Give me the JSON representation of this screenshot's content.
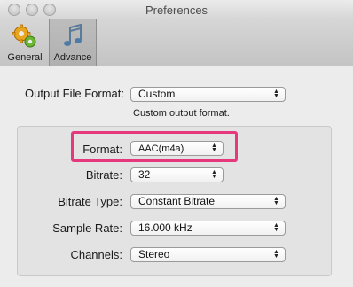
{
  "window": {
    "title": "Preferences"
  },
  "toolbar": {
    "items": [
      {
        "label": "General",
        "icon": "gears-icon",
        "selected": false
      },
      {
        "label": "Advance",
        "icon": "music-note-icon",
        "selected": true
      }
    ]
  },
  "output": {
    "label": "Output File Format:",
    "value": "Custom",
    "description": "Custom output format."
  },
  "settings": {
    "format": {
      "label": "Format:",
      "value": "AAC(m4a)"
    },
    "bitrate": {
      "label": "Bitrate:",
      "value": "32"
    },
    "bitrate_type": {
      "label": "Bitrate Type:",
      "value": "Constant Bitrate"
    },
    "sample_rate": {
      "label": "Sample Rate:",
      "value": "16.000 kHz"
    },
    "channels": {
      "label": "Channels:",
      "value": "Stereo"
    }
  },
  "colors": {
    "highlight": "#e6387d"
  }
}
